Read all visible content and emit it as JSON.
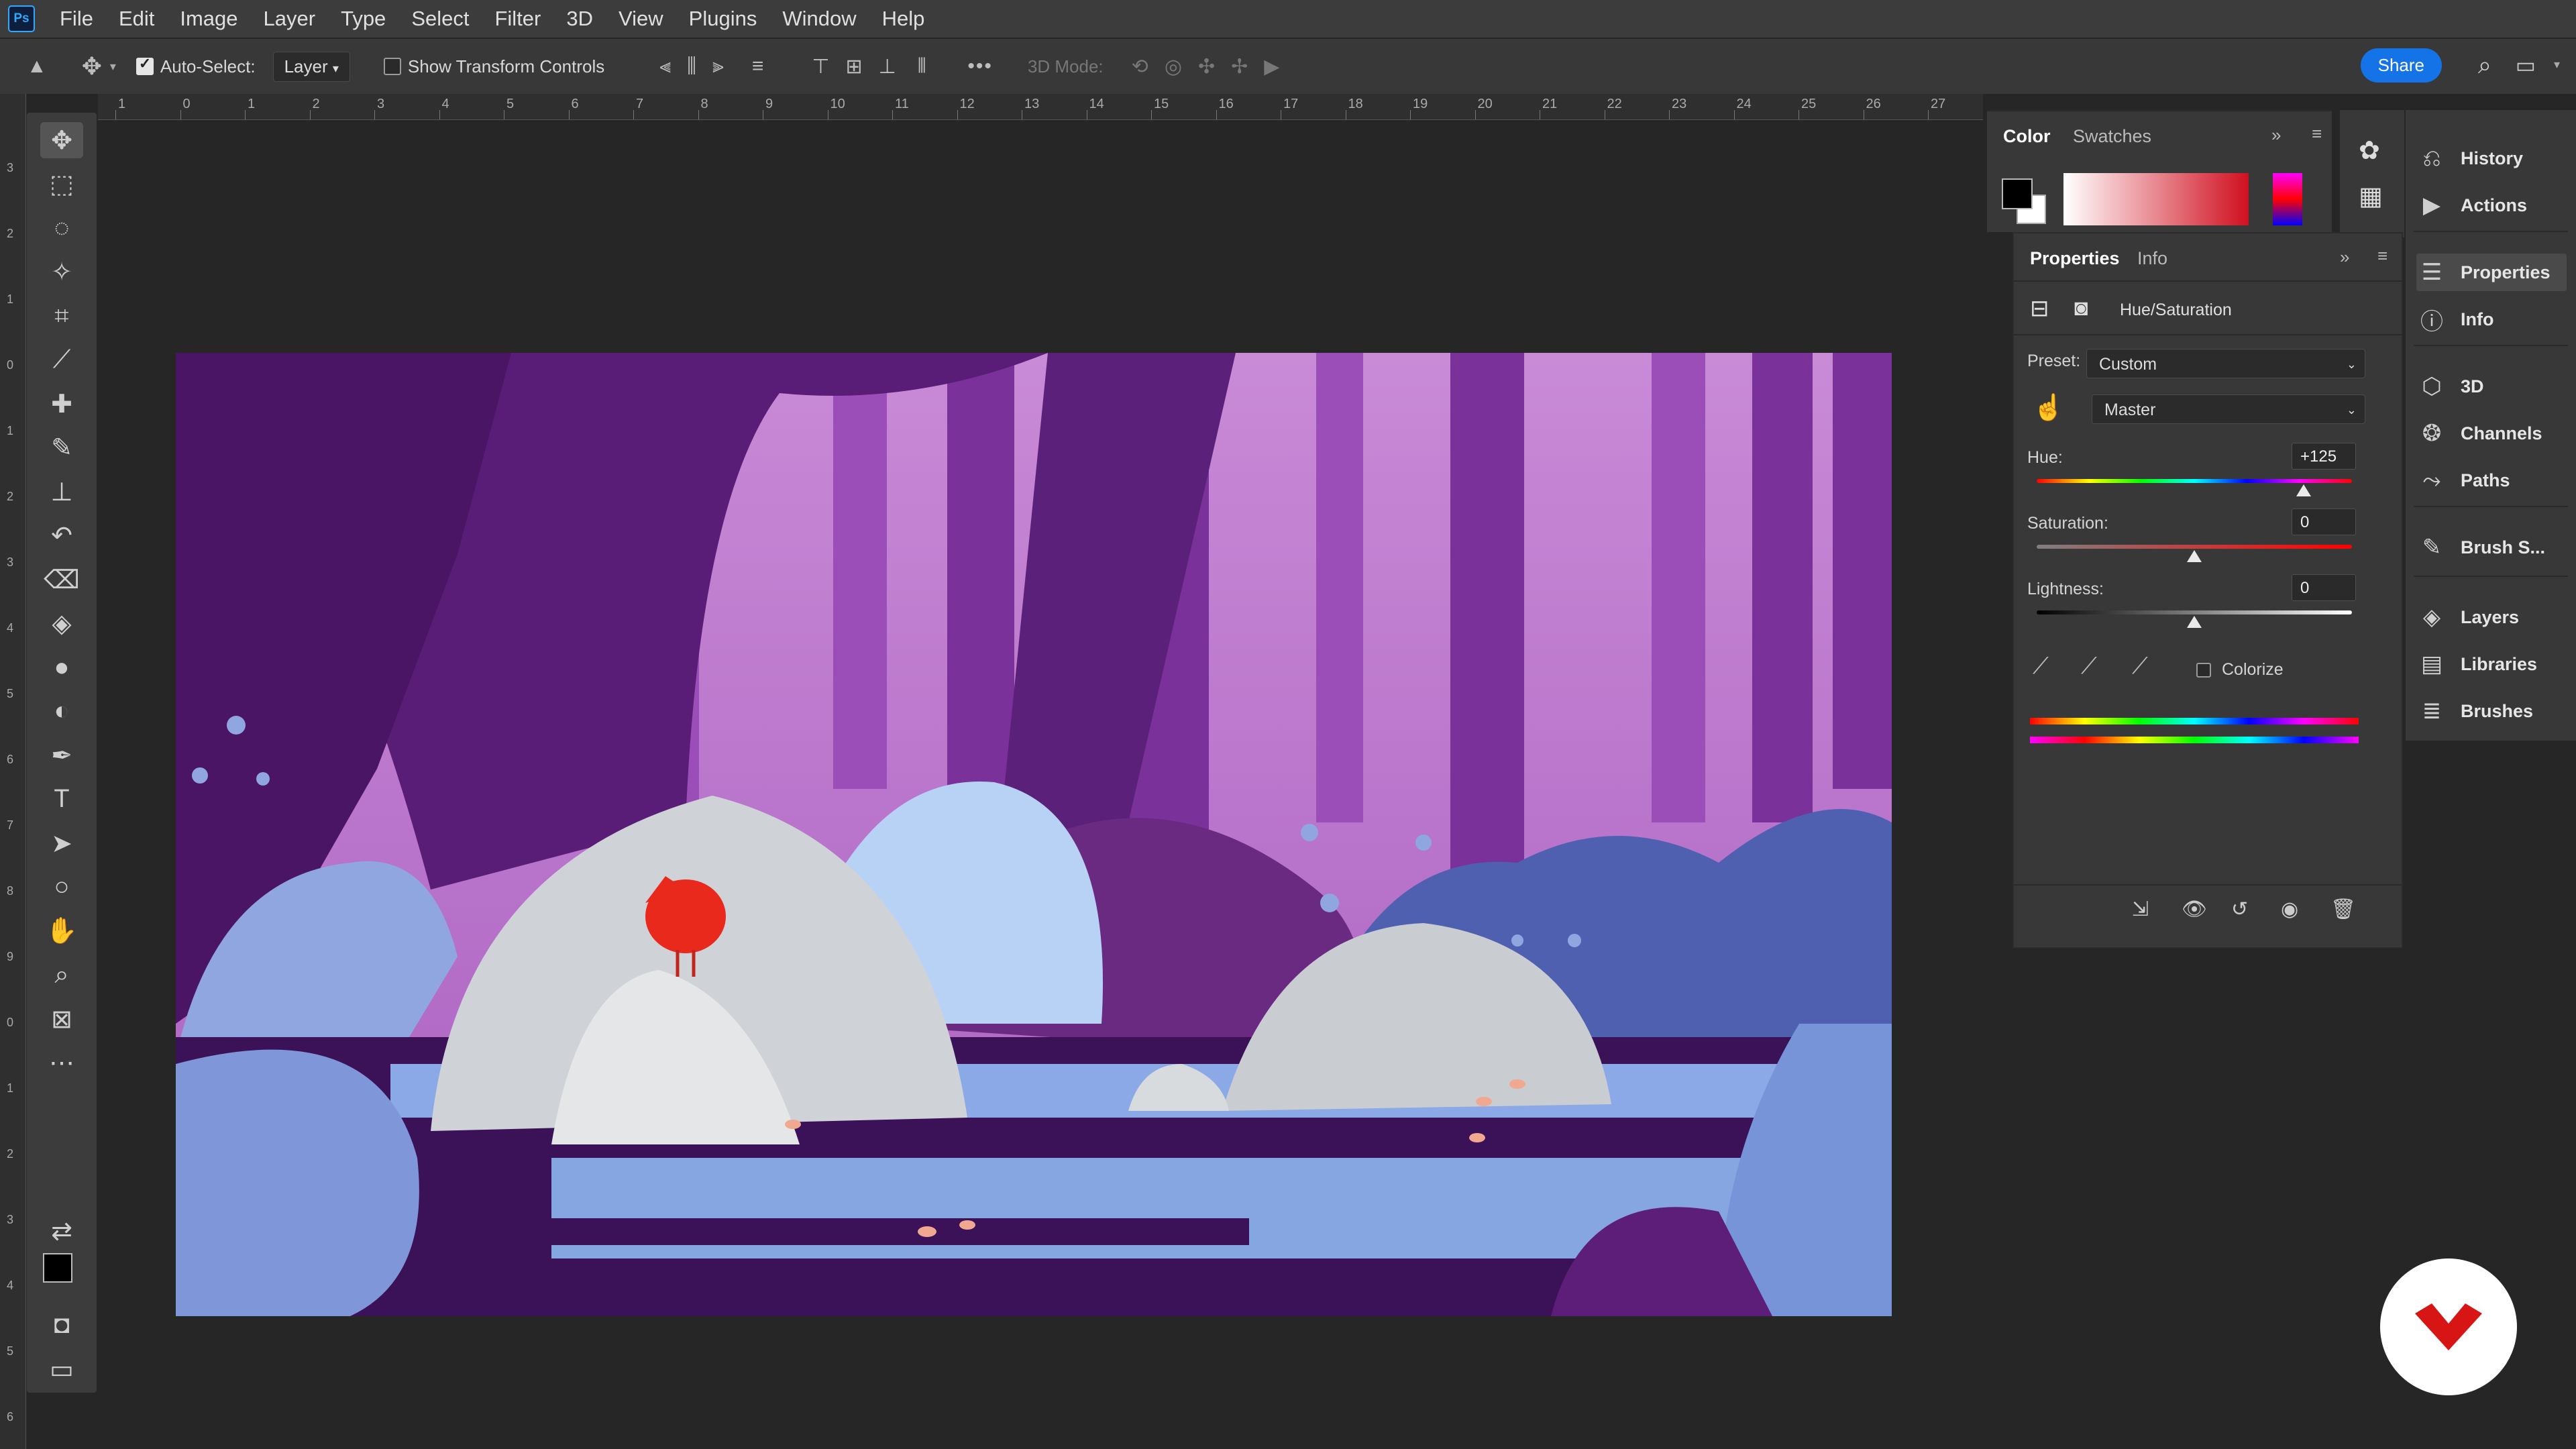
{
  "app": {
    "logo_text": "Ps"
  },
  "menu": [
    "File",
    "Edit",
    "Image",
    "Layer",
    "Type",
    "Select",
    "Filter",
    "3D",
    "View",
    "Plugins",
    "Window",
    "Help"
  ],
  "options": {
    "auto_select_label": "Auto-Select:",
    "auto_select_checked": true,
    "layer_dropdown": "Layer",
    "show_transform_label": "Show Transform Controls",
    "mode_3d_label": "3D Mode:",
    "more_icon": "ellipsis-icon",
    "share_label": "Share"
  },
  "ruler": {
    "top_numbers": [
      "1",
      "0",
      "1",
      "2",
      "3",
      "4",
      "5",
      "6",
      "7",
      "8",
      "9",
      "10",
      "11",
      "12",
      "13",
      "14",
      "15",
      "16",
      "17",
      "18",
      "19",
      "20",
      "21",
      "22",
      "23",
      "24",
      "25",
      "26",
      "27"
    ],
    "left_numbers": [
      "3",
      "2",
      "1",
      "0",
      "1",
      "2",
      "3",
      "4",
      "5",
      "6",
      "7",
      "8",
      "9",
      "0",
      "1",
      "2",
      "3",
      "4",
      "5",
      "6"
    ]
  },
  "tools": [
    "move-tool",
    "marquee-tool",
    "lasso-tool",
    "magic-wand-tool",
    "crop-tool",
    "eyedropper-tool",
    "healing-brush-tool",
    "brush-tool",
    "clone-stamp-tool",
    "history-brush-tool",
    "eraser-tool",
    "paint-bucket-tool",
    "blur-tool",
    "dodge-tool",
    "pen-tool",
    "type-tool",
    "path-selection-tool",
    "ellipse-tool",
    "hand-tool",
    "zoom-tool",
    "frame-tool",
    "more-tools",
    "swap-colors",
    "foreground-color",
    "quick-mask",
    "screen-mode"
  ],
  "color_panel": {
    "tabs": [
      "Color",
      "Swatches"
    ],
    "foreground": "#000000",
    "background": "#ffffff"
  },
  "properties": {
    "tabs": [
      "Properties",
      "Info"
    ],
    "adjustment_title": "Hue/Saturation",
    "preset_label": "Preset:",
    "preset_value": "Custom",
    "channel_value": "Master",
    "hue_label": "Hue:",
    "hue_value": "+125",
    "hue_level": 125,
    "saturation_label": "Saturation:",
    "saturation_value": "0",
    "saturation_level": 0,
    "lightness_label": "Lightness:",
    "lightness_value": "0",
    "lightness_level": 0,
    "colorize_label": "Colorize",
    "colorize_checked": false
  },
  "dock": [
    {
      "label": "History",
      "icon": "history-icon"
    },
    {
      "label": "Actions",
      "icon": "play-icon"
    },
    {
      "label": "Properties",
      "icon": "sliders-icon",
      "active": true
    },
    {
      "label": "Info",
      "icon": "info-icon"
    },
    {
      "label": "3D",
      "icon": "cube-icon"
    },
    {
      "label": "Channels",
      "icon": "channels-icon"
    },
    {
      "label": "Paths",
      "icon": "paths-icon"
    },
    {
      "label": "Brush S...",
      "icon": "brush-settings-icon"
    },
    {
      "label": "Layers",
      "icon": "layers-icon"
    },
    {
      "label": "Libraries",
      "icon": "libraries-icon"
    },
    {
      "label": "Brushes",
      "icon": "brushes-icon"
    }
  ],
  "colors": {
    "accent": "#1473e6",
    "canvas_purple": "#4a1a6a"
  }
}
